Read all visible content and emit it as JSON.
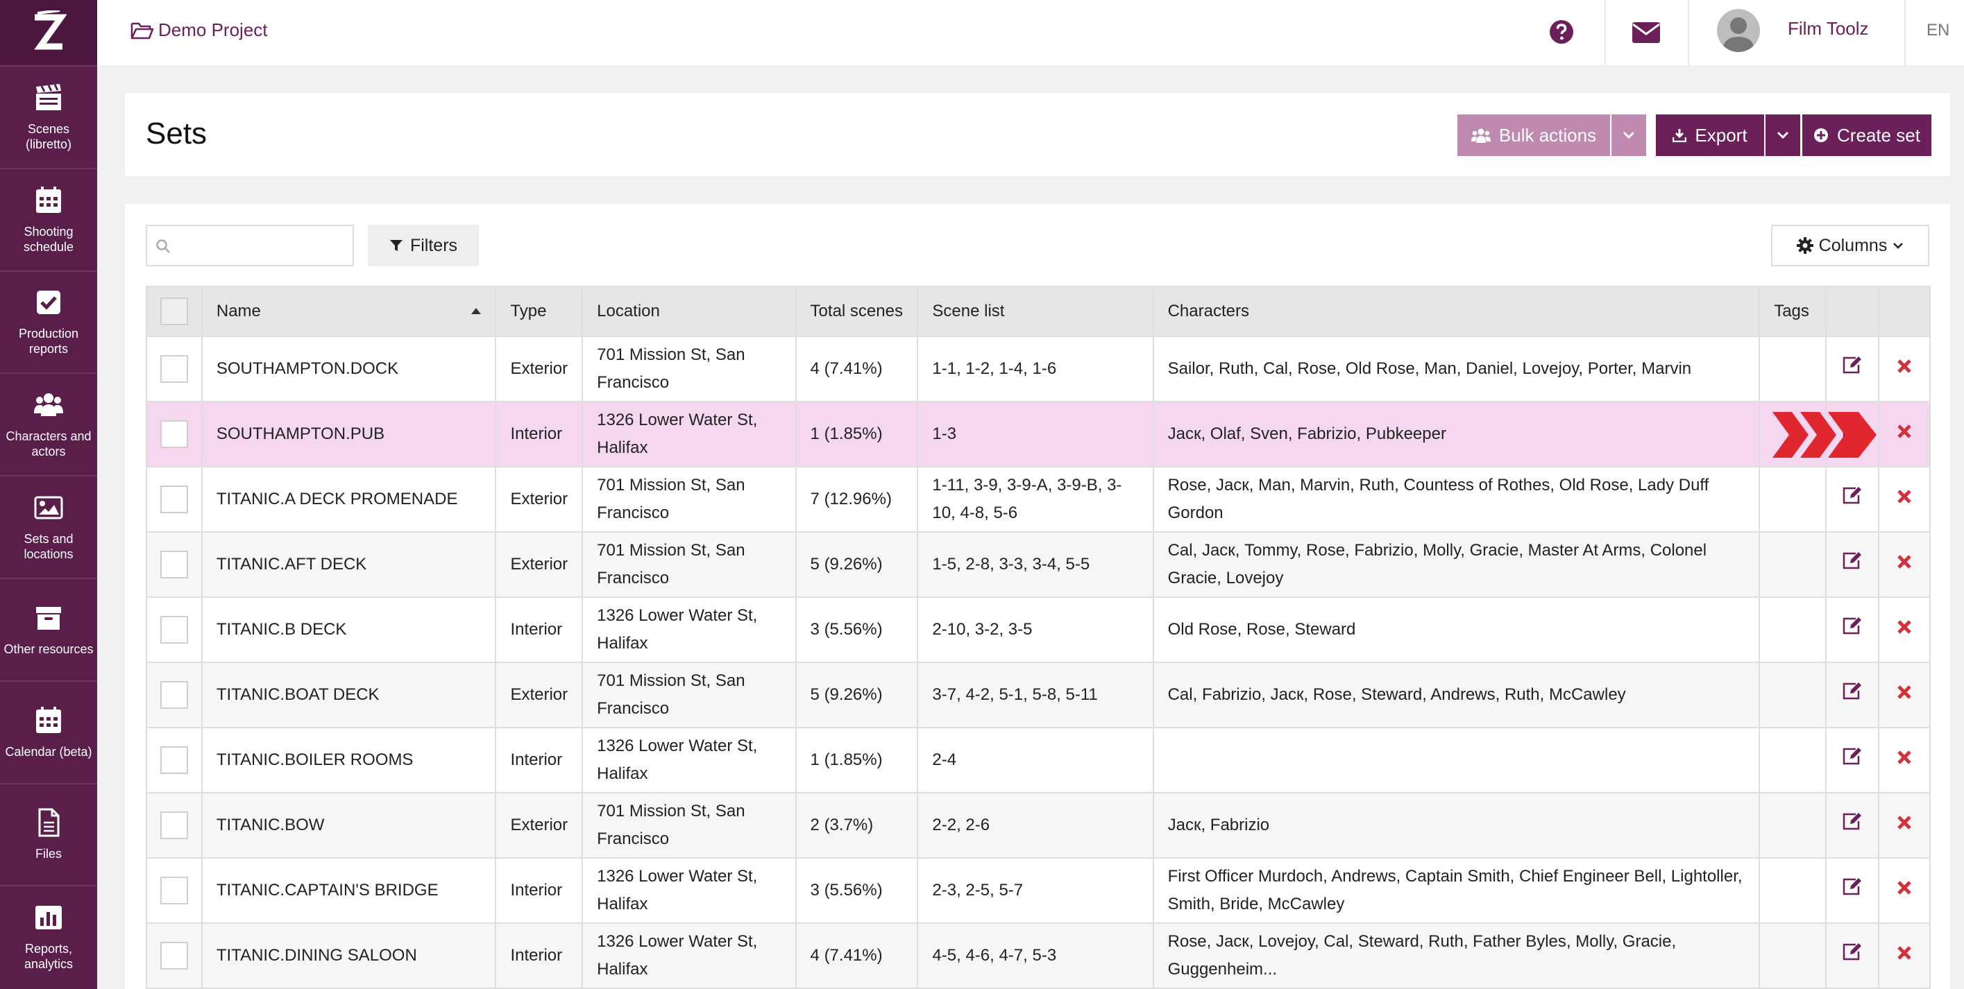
{
  "sidebar": {
    "items": [
      {
        "label": "Scenes (libretto)",
        "icon": "clapperboard-icon"
      },
      {
        "label": "Shooting schedule",
        "icon": "calendar-icon"
      },
      {
        "label": "Production reports",
        "icon": "checkbox-icon"
      },
      {
        "label": "Characters and actors",
        "icon": "users-icon"
      },
      {
        "label": "Sets and locations",
        "icon": "image-icon"
      },
      {
        "label": "Other resources",
        "icon": "archive-box-icon"
      },
      {
        "label": "Calendar (beta)",
        "icon": "calendar-icon"
      },
      {
        "label": "Files",
        "icon": "file-icon"
      },
      {
        "label": "Reports, analytics",
        "icon": "bar-chart-icon"
      }
    ]
  },
  "topbar": {
    "project": "Demo Project",
    "user": "Film Toolz",
    "lang": "EN"
  },
  "page": {
    "title": "Sets",
    "bulk_label": "Bulk actions",
    "export_label": "Export",
    "create_label": "Create set",
    "filters_label": "Filters",
    "columns_label": "Columns",
    "search_placeholder": ""
  },
  "table": {
    "headers": {
      "name": "Name",
      "type": "Type",
      "location": "Location",
      "total": "Total scenes",
      "scenes": "Scene list",
      "chars": "Characters",
      "tags": "Tags"
    },
    "rows": [
      {
        "name": "SOUTHAMPTON.DOCK",
        "type": "Exterior",
        "location": "701 Mission St, San Francisco",
        "total": "4 (7.41%)",
        "scenes": "1-1, 1-2, 1-4, 1-6",
        "chars": "Sailor, Ruth, Cal, Rose, Old Rose, Man, Daniel, Lovejoy, Porter, Marvin"
      },
      {
        "name": "SOUTHAMPTON.PUB",
        "type": "Interior",
        "location": "1326 Lower Water St, Halifax",
        "total": "1 (1.85%)",
        "scenes": "1-3",
        "chars": "Jacк, Olaf, Sven, Fabrizio, Pubkeeper"
      },
      {
        "name": "TITANIC.A DECK PROMENADE",
        "type": "Exterior",
        "location": "701 Mission St, San Francisco",
        "total": "7 (12.96%)",
        "scenes": "1-11, 3-9, 3-9-A, 3-9-B, 3-10, 4-8, 5-6",
        "chars": "Rose, Jacк, Man, Marvin, Ruth, Countess of Rothes, Old Rose, Lady Duff Gordon"
      },
      {
        "name": "TITANIC.AFT DECK",
        "type": "Exterior",
        "location": "701 Mission St, San Francisco",
        "total": "5 (9.26%)",
        "scenes": "1-5, 2-8, 3-3, 3-4, 5-5",
        "chars": "Cal, Jacк, Tommy, Rose, Fabrizio, Molly, Gracie, Master At Arms, Colonel Gracie, Lovejoy"
      },
      {
        "name": "TITANIC.B DECK",
        "type": "Interior",
        "location": "1326 Lower Water St, Halifax",
        "total": "3 (5.56%)",
        "scenes": "2-10, 3-2, 3-5",
        "chars": "Old Rose, Rose, Steward"
      },
      {
        "name": "TITANIC.BOAT DECK",
        "type": "Exterior",
        "location": "701 Mission St, San Francisco",
        "total": "5 (9.26%)",
        "scenes": "3-7, 4-2, 5-1, 5-8, 5-11",
        "chars": "Cal, Fabrizio, Jacк, Rose, Steward, Andrews, Ruth, McCawley"
      },
      {
        "name": "TITANIC.BOILER ROOMS",
        "type": "Interior",
        "location": "1326 Lower Water St, Halifax",
        "total": "1 (1.85%)",
        "scenes": "2-4",
        "chars": ""
      },
      {
        "name": "TITANIC.BOW",
        "type": "Exterior",
        "location": "701 Mission St, San Francisco",
        "total": "2 (3.7%)",
        "scenes": "2-2, 2-6",
        "chars": "Jacк, Fabrizio"
      },
      {
        "name": "TITANIC.CAPTAIN'S BRIDGE",
        "type": "Interior",
        "location": "1326 Lower Water St, Halifax",
        "total": "3 (5.56%)",
        "scenes": "2-3, 2-5, 5-7",
        "chars": "First Officer Murdoch, Andrews, Captain Smith, Chief Engineer Bell, Lightoller, Smith, Bride, McCawley"
      },
      {
        "name": "TITANIC.DINING SALOON",
        "type": "Interior",
        "location": "1326 Lower Water St, Halifax",
        "total": "4 (7.41%)",
        "scenes": "4-5, 4-6, 4-7, 5-3",
        "chars": "Rose, Jacк, Lovejoy, Cal, Steward, Ruth, Father Byles, Molly, Gracie, Guggenheim..."
      }
    ],
    "highlighted_row": 1
  },
  "colors": {
    "brand": "#6b2059",
    "sidebar": "#5a1e4b",
    "delete": "#d0313a",
    "highlight": "#f6d7f0"
  }
}
